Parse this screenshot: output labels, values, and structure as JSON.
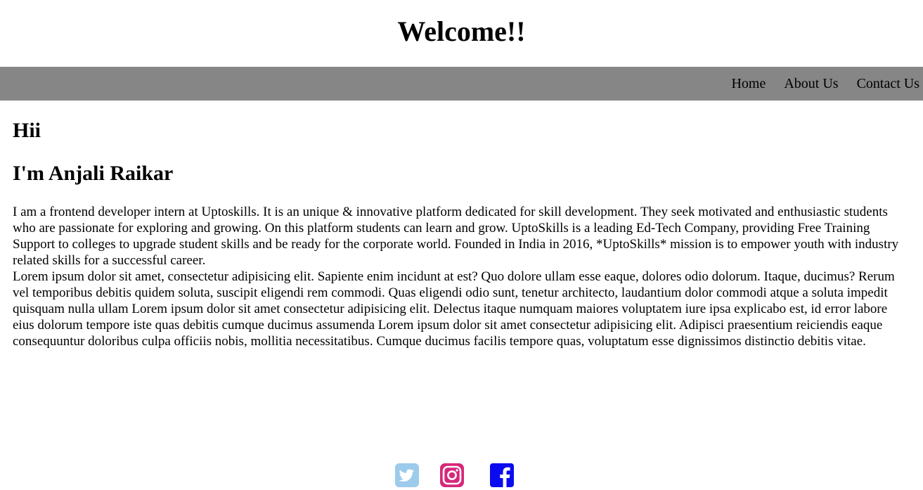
{
  "header": {
    "title": "Welcome!!"
  },
  "nav": {
    "items": [
      {
        "label": "Home"
      },
      {
        "label": "About Us"
      },
      {
        "label": "Contact Us"
      }
    ]
  },
  "main": {
    "greeting": "Hii",
    "name_heading": "I'm Anjali Raikar",
    "bio_paragraph_1": "I am a frontend developer intern at Uptoskills. It is an unique & innovative platform dedicated for skill development. They seek motivated and enthusiastic students who are passionate for exploring and growing. On this platform students can learn and grow. UptoSkills is a leading Ed-Tech Company, providing Free Training Support to colleges to upgrade student skills and be ready for the corporate world. Founded in India in 2016, *UptoSkills* mission is to empower youth with industry related skills for a successful career.",
    "bio_paragraph_2": "Lorem ipsum dolor sit amet, consectetur adipisicing elit. Sapiente enim incidunt at est? Quo dolore ullam esse eaque, dolores odio dolorum. Itaque, ducimus? Rerum vel temporibus debitis quidem soluta, suscipit eligendi rem commodi. Quas eligendi odio sunt, tenetur architecto, laudantium dolor commodi atque a soluta impedit quisquam nulla ullam Lorem ipsum dolor sit amet consectetur adipisicing elit. Delectus itaque numquam maiores voluptatem iure ipsa explicabo est, id error labore eius dolorum tempore iste quas debitis cumque ducimus assumenda Lorem ipsum dolor sit amet consectetur adipisicing elit. Adipisci praesentium reiciendis eaque consequuntur doloribus culpa officiis nobis, mollitia necessitatibus. Cumque ducimus facilis tempore quas, voluptatum esse dignissimos distinctio debitis vitae."
  },
  "footer": {
    "social": [
      {
        "icon": "twitter-icon",
        "color": "#9ccbeb"
      },
      {
        "icon": "instagram-icon",
        "color": "#d6287a"
      },
      {
        "icon": "facebook-icon",
        "color": "#0b0bf0"
      }
    ]
  },
  "colors": {
    "nav_background": "#868686",
    "page_background": "#ffffff",
    "text": "#000000"
  }
}
